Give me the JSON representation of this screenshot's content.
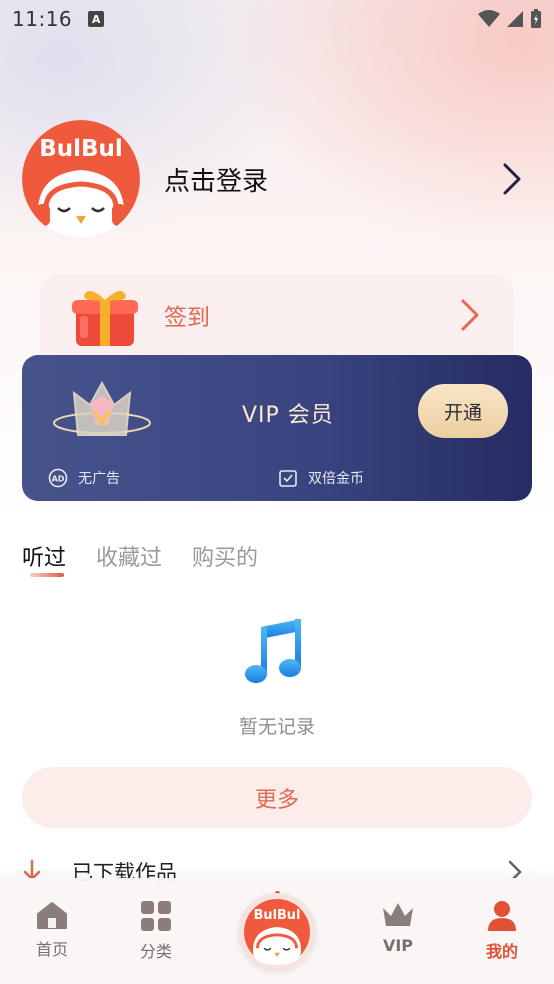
{
  "status": {
    "time": "11:16",
    "notify_glyph": "A"
  },
  "profile": {
    "login_label": "点击登录",
    "logo_text": "BulBul"
  },
  "signin": {
    "label": "签到"
  },
  "vip": {
    "title": "VIP 会员",
    "open_label": "开通",
    "perks": [
      {
        "label": "无广告",
        "icon": "ad-free-icon"
      },
      {
        "label": "双倍金币",
        "icon": "checkbox-icon"
      }
    ]
  },
  "tabs": [
    {
      "label": "听过",
      "active": true
    },
    {
      "label": "收藏过",
      "active": false
    },
    {
      "label": "购买的",
      "active": false
    }
  ],
  "empty": {
    "text": "暂无记录",
    "icon": "music-note-icon"
  },
  "more": {
    "label": "更多"
  },
  "downloads": {
    "label": "已下载作品"
  },
  "nav": {
    "items": [
      {
        "label": "首页",
        "icon": "home-icon"
      },
      {
        "label": "分类",
        "icon": "grid-icon"
      },
      {
        "label": "VIP",
        "icon": "crown-icon"
      },
      {
        "label": "我的",
        "icon": "user-icon",
        "active": true
      }
    ],
    "center_logo": "BulBul"
  },
  "colors": {
    "accent": "#e25035",
    "vip_bg": "#3a4580",
    "gold": "#eccf9f"
  }
}
